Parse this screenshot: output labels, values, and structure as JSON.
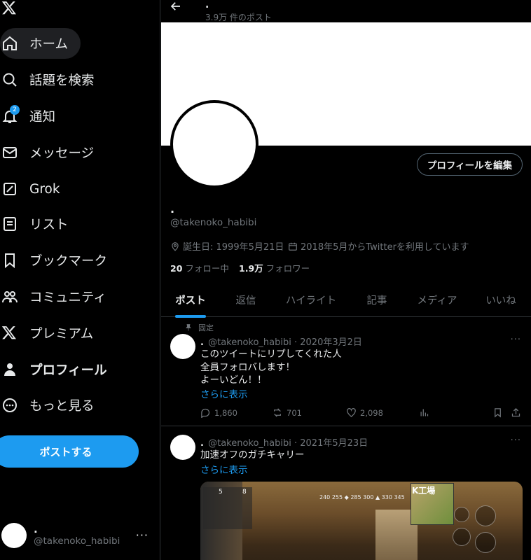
{
  "sidebar": {
    "logo_icon": "x-logo-icon",
    "items": [
      {
        "label": "ホーム",
        "icon": "home-icon"
      },
      {
        "label": "話題を検索",
        "icon": "search-icon"
      },
      {
        "label": "通知",
        "icon": "bell-icon",
        "badge": "2"
      },
      {
        "label": "メッセージ",
        "icon": "mail-icon"
      },
      {
        "label": "Grok",
        "icon": "grok-icon"
      },
      {
        "label": "リスト",
        "icon": "list-icon"
      },
      {
        "label": "ブックマーク",
        "icon": "bookmark-icon"
      },
      {
        "label": "コミュニティ",
        "icon": "community-icon"
      },
      {
        "label": "プレミアム",
        "icon": "x-logo-icon"
      },
      {
        "label": "プロフィール",
        "icon": "person-icon"
      },
      {
        "label": "もっと見る",
        "icon": "more-circle-icon"
      }
    ],
    "post_button": "ポストする",
    "account": {
      "name": ".",
      "handle": "@takenoko_habibi",
      "more": "···"
    }
  },
  "header": {
    "name": ".",
    "post_count": "3.9万 件のポスト"
  },
  "profile": {
    "name": ".",
    "handle": "@takenoko_habibi",
    "edit_button": "プロフィールを編集",
    "birthday": "誕生日: 1999年5月21日",
    "joined": "2018年5月からTwitterを利用しています",
    "following_count": "20",
    "following_label": "フォロー中",
    "followers_count": "1.9万",
    "followers_label": "フォロワー"
  },
  "tabs": [
    "ポスト",
    "返信",
    "ハイライト",
    "記事",
    "メディア",
    "いいね"
  ],
  "tweets": [
    {
      "pinned_label": "固定",
      "name": ".",
      "meta": "@takenoko_habibi · 2020年3月2日",
      "text": "このツイートにリプしてくれた人\n全員フォロバします！\nよーいどん！！",
      "show_more": "さらに表示",
      "replies": "1,860",
      "retweets": "701",
      "likes": "2,098"
    },
    {
      "name": ".",
      "meta": "@takenoko_habibi · 2021年5月23日",
      "text": "加速オフのガチキャリー",
      "show_more": "さらに表示",
      "media_hud": {
        "location": "K工場",
        "stats": "240 255 ◆ 285 300 ▲ 330 345",
        "levels": [
          "5",
          "8"
        ]
      }
    }
  ],
  "colors": {
    "accent": "#1d9bf0",
    "background": "#000000",
    "muted": "#71767b",
    "border": "#2f3336"
  }
}
